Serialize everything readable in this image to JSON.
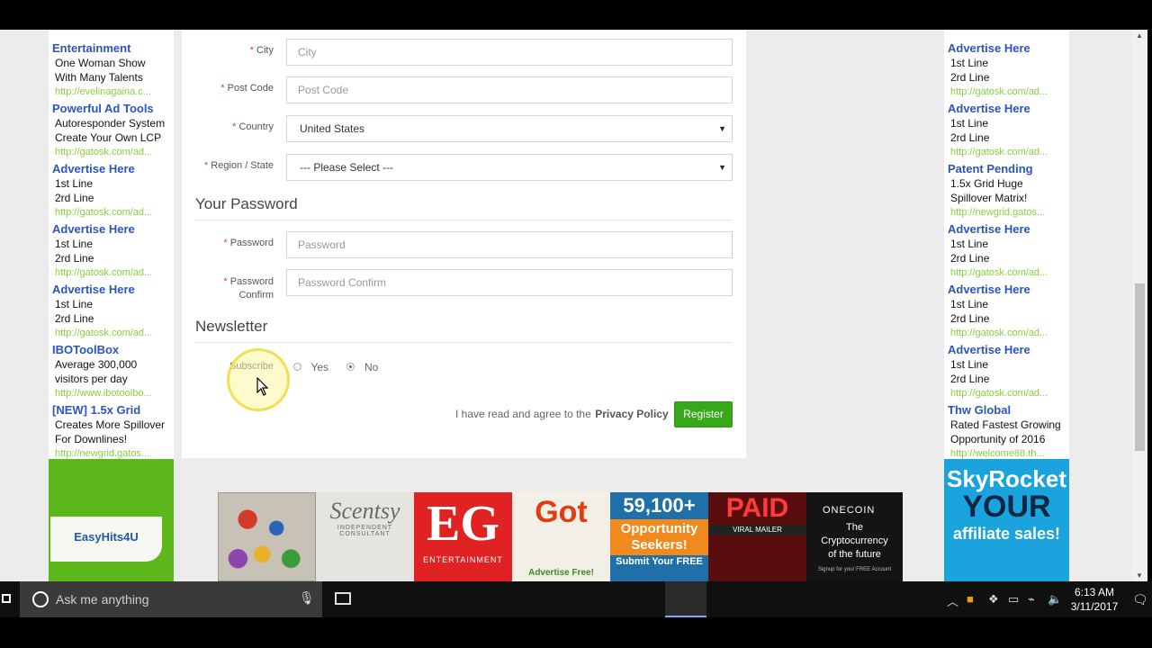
{
  "left_ads": [
    {
      "title": "Entertainment",
      "lines": [
        "One Woman Show",
        "With Many Talents"
      ],
      "url": "http://evelinagaina.c..."
    },
    {
      "title": "Powerful Ad Tools",
      "lines": [
        "Autoresponder System",
        "Create Your Own LCP"
      ],
      "url": "http://gatosk.com/ad..."
    },
    {
      "title": "Advertise Here",
      "lines": [
        "1st Line",
        "2rd Line"
      ],
      "url": "http://gatosk.com/ad..."
    },
    {
      "title": "Advertise Here",
      "lines": [
        "1st Line",
        "2rd Line"
      ],
      "url": "http://gatosk.com/ad..."
    },
    {
      "title": "Advertise Here",
      "lines": [
        "1st Line",
        "2rd Line"
      ],
      "url": "http://gatosk.com/ad..."
    },
    {
      "title": "IBOToolBox",
      "lines": [
        "Average 300,000",
        "visitors per day"
      ],
      "url": "http://www.ibotoolbo..."
    },
    {
      "title": "[NEW] 1.5x Grid",
      "lines": [
        "Creates More Spillover",
        "For Downlines!"
      ],
      "url": "http://newgrid.gatos..."
    }
  ],
  "right_ads": [
    {
      "title": "Advertise Here",
      "lines": [
        "1st Line",
        "2rd Line"
      ],
      "url": "http://gatosk.com/ad..."
    },
    {
      "title": "Advertise Here",
      "lines": [
        "1st Line",
        "2rd Line"
      ],
      "url": "http://gatosk.com/ad..."
    },
    {
      "title": "Patent Pending",
      "lines": [
        "1.5x Grid Huge",
        "Spillover Matrix!"
      ],
      "url": "http://newgrid.gatos..."
    },
    {
      "title": "Advertise Here",
      "lines": [
        "1st Line",
        "2rd Line"
      ],
      "url": "http://gatosk.com/ad..."
    },
    {
      "title": "Advertise Here",
      "lines": [
        "1st Line",
        "2rd Line"
      ],
      "url": "http://gatosk.com/ad..."
    },
    {
      "title": "Advertise Here",
      "lines": [
        "1st Line",
        "2rd Line"
      ],
      "url": "http://gatosk.com/ad..."
    },
    {
      "title": "Thw Global",
      "lines": [
        "Rated Fastest Growing",
        "Opportunity of 2016"
      ],
      "url": "http://welcome88.th..."
    }
  ],
  "form": {
    "city": {
      "label": "City",
      "placeholder": "City"
    },
    "post_code": {
      "label": "Post Code",
      "placeholder": "Post Code"
    },
    "country": {
      "label": "Country",
      "value": "United States"
    },
    "region": {
      "label": "Region / State",
      "value": "--- Please Select ---"
    },
    "password_section": "Your Password",
    "password": {
      "label": "Password",
      "placeholder": "Password"
    },
    "password_confirm": {
      "label_1": "Password",
      "label_2": "Confirm",
      "placeholder": "Password Confirm"
    },
    "newsletter_section": "Newsletter",
    "subscribe": {
      "label": "Subscribe",
      "yes": "Yes",
      "no": "No",
      "selected": "No"
    },
    "agree_text": "I have read and agree to the",
    "privacy_link": "Privacy Policy",
    "register_label": "Register"
  },
  "banners": {
    "easyhits": "EasyHits4U",
    "skyrocket": {
      "line1": "SkyRocket",
      "line2": "YOUR",
      "line3": "affiliate sales!"
    },
    "scentsy": "Scentsy",
    "scentsy_sub": "INDEPENDENT CONSULTANT",
    "eg": "EG",
    "eg_sub": "ENTERTAINMENT",
    "got": "Got",
    "got_sub": "Advertise Free!",
    "num": "59,100+",
    "opp": "Opportunity Seekers!",
    "submit": "Submit Your FREE",
    "paid": "PAID",
    "paid_sub": "VIRAL MAILER",
    "onecoin": "ONECOIN",
    "onecoin_text": [
      "The",
      "Cryptocurrency",
      "of the future"
    ],
    "onecoin_small": "Signup for your FREE Account"
  },
  "taskbar": {
    "search_placeholder": "Ask me anything",
    "time": "6:13 AM",
    "date": "3/11/2017"
  }
}
